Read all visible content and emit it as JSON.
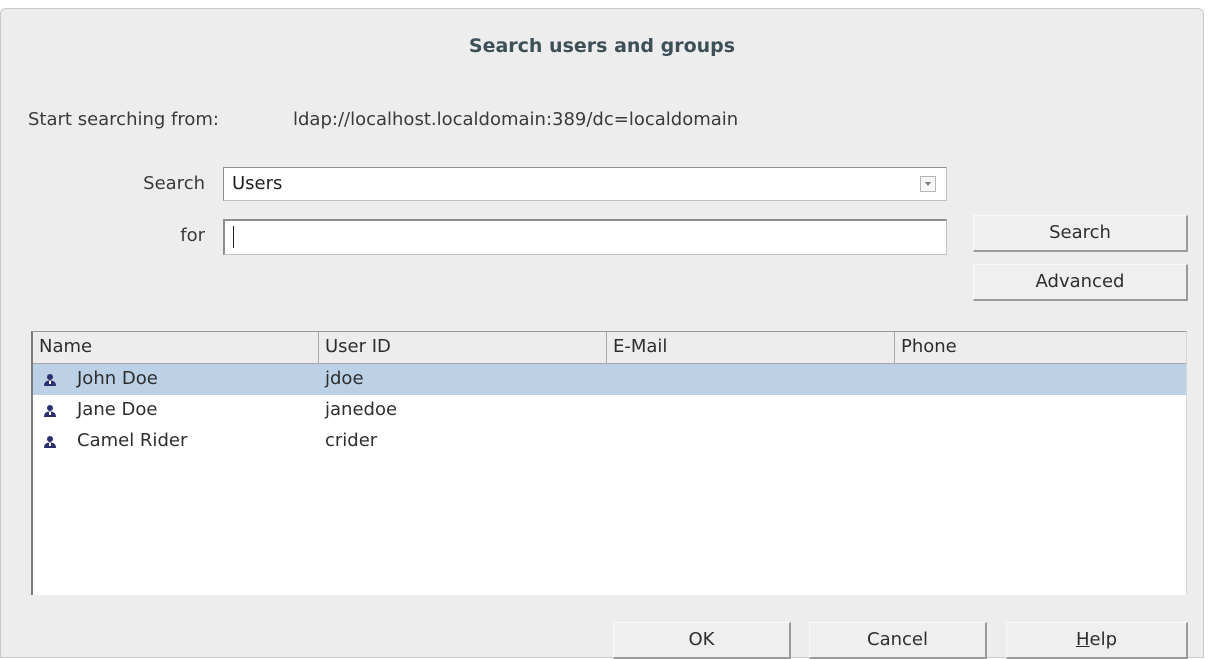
{
  "dialog": {
    "title": "Search users and groups",
    "start_label": "Start searching from:",
    "start_value": "ldap://localhost.localdomain:389/dc=localdomain"
  },
  "form": {
    "search_label": "Search",
    "search_value": "Users",
    "for_label": "for",
    "for_value": ""
  },
  "buttons": {
    "search": "Search",
    "advanced": "Advanced",
    "ok": "OK",
    "cancel": "Cancel",
    "help": "Help"
  },
  "table": {
    "columns": [
      "Name",
      "User ID",
      "E-Mail",
      "Phone"
    ],
    "rows": [
      {
        "name": "John Doe",
        "user_id": "jdoe",
        "email": "",
        "phone": "",
        "selected": true,
        "icon": "user-icon"
      },
      {
        "name": "Jane Doe",
        "user_id": "janedoe",
        "email": "",
        "phone": "",
        "selected": false,
        "icon": "user-icon"
      },
      {
        "name": "Camel Rider",
        "user_id": "crider",
        "email": "",
        "phone": "",
        "selected": false,
        "icon": "user-icon"
      }
    ]
  },
  "colors": {
    "selection": "#bcd0e6",
    "title": "#3d5058",
    "user_icon": "#2b2f6e"
  }
}
